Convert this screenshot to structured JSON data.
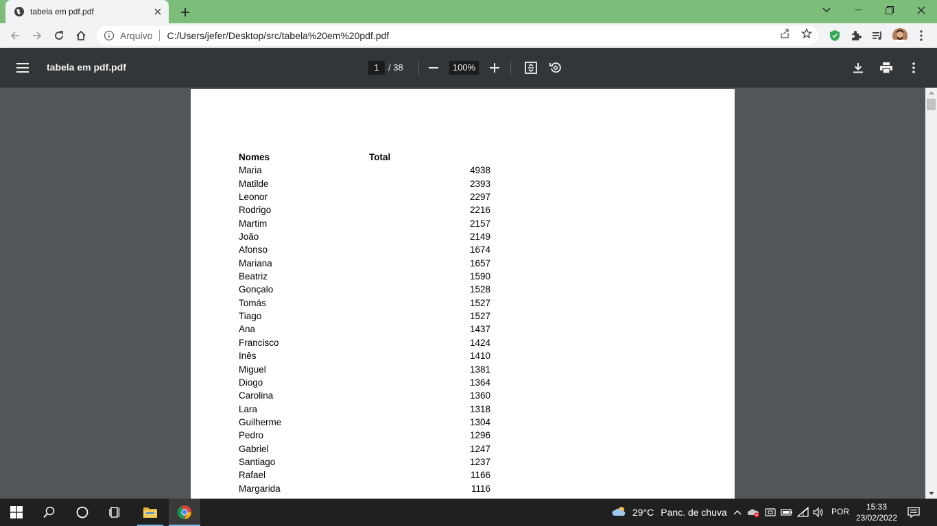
{
  "browser": {
    "tab_title": "tabela em pdf.pdf",
    "scheme_label": "Arquivo",
    "url": "C:/Users/jefer/Desktop/src/tabela%20em%20pdf.pdf"
  },
  "pdf_toolbar": {
    "title": "tabela em pdf.pdf",
    "current_page": "1",
    "total_pages": "/ 38",
    "zoom": "100%"
  },
  "table": {
    "header_name": "Nomes",
    "header_total": "Total",
    "rows": [
      {
        "name": "Maria",
        "total": "4938"
      },
      {
        "name": "Matilde",
        "total": "2393"
      },
      {
        "name": "Leonor",
        "total": "2297"
      },
      {
        "name": "Rodrigo",
        "total": "2216"
      },
      {
        "name": "Martim",
        "total": "2157"
      },
      {
        "name": "João",
        "total": "2149"
      },
      {
        "name": "Afonso",
        "total": "1674"
      },
      {
        "name": "Mariana",
        "total": "1657"
      },
      {
        "name": "Beatriz",
        "total": "1590"
      },
      {
        "name": "Gonçalo",
        "total": "1528"
      },
      {
        "name": "Tomás",
        "total": "1527"
      },
      {
        "name": "Tiago",
        "total": "1527"
      },
      {
        "name": "Ana",
        "total": "1437"
      },
      {
        "name": "Francisco",
        "total": "1424"
      },
      {
        "name": "Inês",
        "total": "1410"
      },
      {
        "name": "Miguel",
        "total": "1381"
      },
      {
        "name": "Diogo",
        "total": "1364"
      },
      {
        "name": "Carolina",
        "total": "1360"
      },
      {
        "name": "Lara",
        "total": "1318"
      },
      {
        "name": "Guilherme",
        "total": "1304"
      },
      {
        "name": "Pedro",
        "total": "1296"
      },
      {
        "name": "Gabriel",
        "total": "1247"
      },
      {
        "name": "Santiago",
        "total": "1237"
      },
      {
        "name": "Rafael",
        "total": "1166"
      },
      {
        "name": "Margarida",
        "total": "1116"
      }
    ]
  },
  "taskbar": {
    "temperature": "29°C",
    "weather_desc": "Panc. de chuva",
    "language": "POR",
    "time": "15:33",
    "date": "23/02/2022"
  },
  "colors": {
    "titlebar": "#7dbd7a",
    "pdf_toolbar": "#323639",
    "viewer_bg": "#525659",
    "taskbar": "#202020"
  }
}
